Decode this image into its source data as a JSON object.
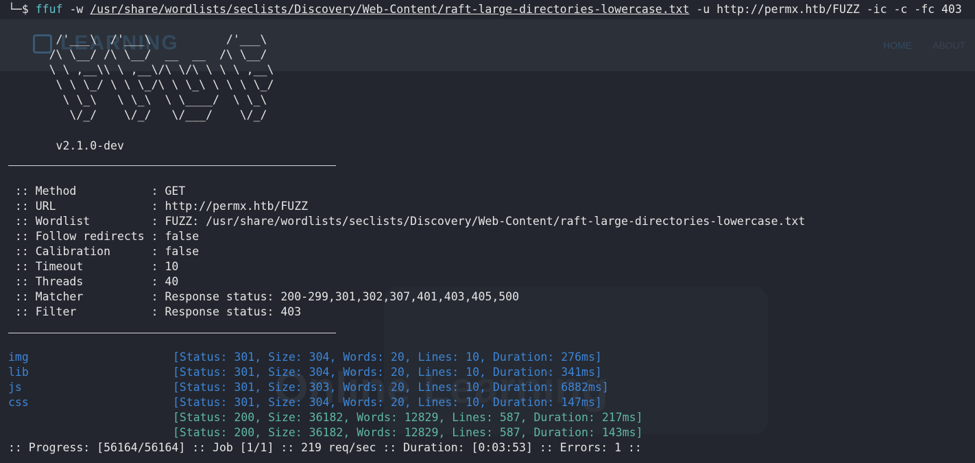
{
  "background_site": {
    "logo_text": "LEARNING",
    "nav": [
      "HOME",
      "ABOUT"
    ],
    "hero_title": "Online Learning",
    "hero_subtitle": ""
  },
  "command": {
    "prompt": "└─$",
    "tool": "ffuf",
    "arg1": "-w",
    "wordlist_path": "/usr/share/wordlists/seclists/Discovery/Web-Content/raft-large-directories-lowercase.txt",
    "rest": "-u http://permx.htb/FUZZ -ic -c -fc 403"
  },
  "banner": [
    "       /'___\\  /'___\\           /'___\\",
    "      /\\ \\__/ /\\ \\__/  __  __  /\\ \\__/",
    "      \\ \\ ,__\\\\ \\ ,__\\/\\ \\/\\ \\ \\ \\ ,__\\",
    "       \\ \\ \\_/ \\ \\ \\_/\\ \\ \\_\\ \\ \\ \\ \\_/",
    "        \\ \\_\\   \\ \\_\\  \\ \\____/  \\ \\_\\",
    "         \\/_/    \\/_/   \\/___/    \\/_/"
  ],
  "version": "       v2.1.0-dev",
  "config": [
    {
      "key": " :: Method           ",
      "value": ": GET"
    },
    {
      "key": " :: URL              ",
      "value": ": http://permx.htb/FUZZ"
    },
    {
      "key": " :: Wordlist         ",
      "value": ": FUZZ: /usr/share/wordlists/seclists/Discovery/Web-Content/raft-large-directories-lowercase.txt"
    },
    {
      "key": " :: Follow redirects ",
      "value": ": false"
    },
    {
      "key": " :: Calibration      ",
      "value": ": false"
    },
    {
      "key": " :: Timeout          ",
      "value": ": 10"
    },
    {
      "key": " :: Threads          ",
      "value": ": 40"
    },
    {
      "key": " :: Matcher          ",
      "value": ": Response status: 200-299,301,302,307,401,403,405,500"
    },
    {
      "key": " :: Filter           ",
      "value": ": Response status: 403"
    }
  ],
  "results": [
    {
      "path": "img",
      "info": "[Status: 301, Size: 304, Words: 20, Lines: 10, Duration: 276ms]",
      "status_color": "#3d86d8"
    },
    {
      "path": "lib",
      "info": "[Status: 301, Size: 304, Words: 20, Lines: 10, Duration: 341ms]",
      "status_color": "#3d86d8"
    },
    {
      "path": "js",
      "info": "[Status: 301, Size: 303, Words: 20, Lines: 10, Duration: 6882ms]",
      "status_color": "#3d86d8"
    },
    {
      "path": "css",
      "info": "[Status: 301, Size: 304, Words: 20, Lines: 10, Duration: 147ms]",
      "status_color": "#3d86d8"
    },
    {
      "path": "",
      "info": "[Status: 200, Size: 36182, Words: 12829, Lines: 587, Duration: 217ms]",
      "status_color": "#5fb7a8"
    },
    {
      "path": "",
      "info": "[Status: 200, Size: 36182, Words: 12829, Lines: 587, Duration: 143ms]",
      "status_color": "#5fb7a8"
    }
  ],
  "progress_line": ":: Progress: [56164/56164] :: Job [1/1] :: 219 req/sec :: Duration: [0:03:53] :: Errors: 1 ::",
  "colors": {
    "terminal_bg": "#23262e",
    "command": "#5ec4d0",
    "redirect_result": "#3d86d8",
    "ok_result": "#5fb7a8"
  }
}
